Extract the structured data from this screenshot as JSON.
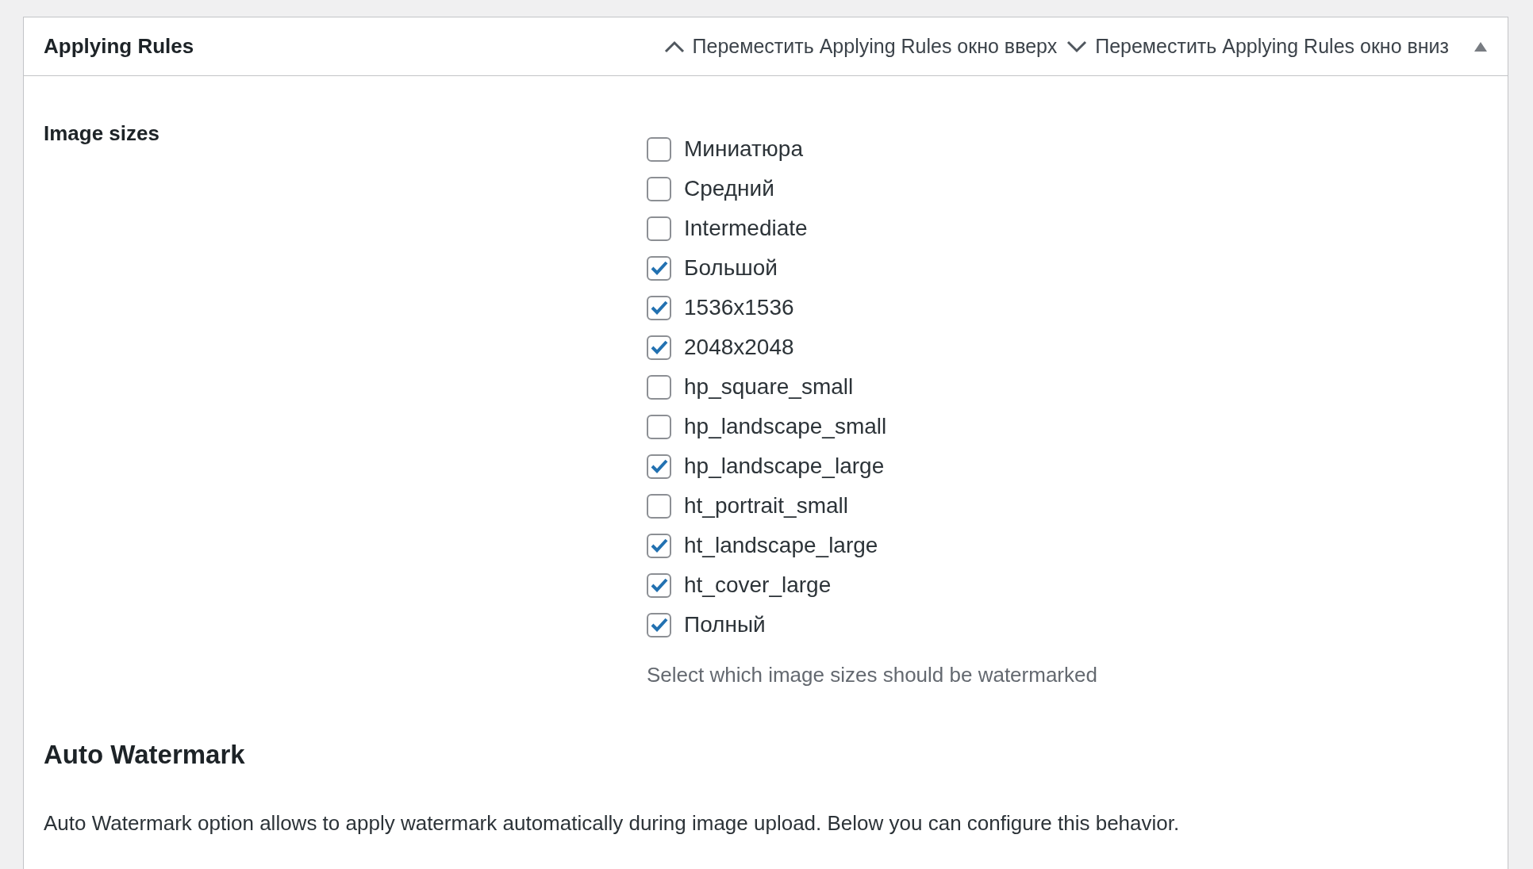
{
  "panel": {
    "title": "Applying Rules",
    "move_up": {
      "label": "Переместить Applying Rules окно вверх"
    },
    "move_down": {
      "label": "Переместить Applying Rules окно вниз"
    },
    "expanded": true
  },
  "image_sizes": {
    "label": "Image sizes",
    "options": [
      {
        "label": "Миниатюра",
        "checked": false
      },
      {
        "label": "Средний",
        "checked": false
      },
      {
        "label": "Intermediate",
        "checked": false
      },
      {
        "label": "Большой",
        "checked": true
      },
      {
        "label": "1536x1536",
        "checked": true
      },
      {
        "label": "2048x2048",
        "checked": true
      },
      {
        "label": "hp_square_small",
        "checked": false
      },
      {
        "label": "hp_landscape_small",
        "checked": false
      },
      {
        "label": "hp_landscape_large",
        "checked": true
      },
      {
        "label": "ht_portrait_small",
        "checked": false
      },
      {
        "label": "ht_landscape_large",
        "checked": true
      },
      {
        "label": "ht_cover_large",
        "checked": true
      },
      {
        "label": "Полный",
        "checked": true
      }
    ],
    "description": "Select which image sizes should be watermarked"
  },
  "auto_watermark": {
    "heading": "Auto Watermark",
    "text": "Auto Watermark option allows to apply watermark automatically during image upload. Below you can configure this behavior."
  }
}
